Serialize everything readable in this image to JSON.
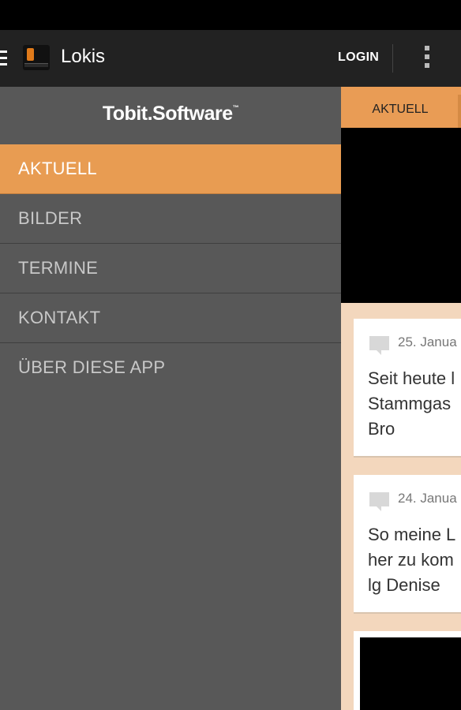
{
  "app": {
    "title": "Lokis"
  },
  "actionbar": {
    "login_label": "LOGIN"
  },
  "drawer": {
    "brand": "Tobit.Software",
    "brand_tm": "™",
    "items": [
      {
        "label": "AKTUELL",
        "active": true
      },
      {
        "label": "BILDER"
      },
      {
        "label": "TERMINE"
      },
      {
        "label": "KONTAKT"
      },
      {
        "label": "ÜBER DIESE APP"
      }
    ]
  },
  "content": {
    "tab_label": "AKTUELL",
    "posts": [
      {
        "date": "25. Janua",
        "text": "Seit heute l\nStammgas\nBro"
      },
      {
        "date": "24. Janua",
        "text": "So meine L\nher zu kom\nlg Denise"
      }
    ]
  },
  "colors": {
    "accent": "#e89c52",
    "drawer_bg": "#585858",
    "actionbar_bg": "#222222",
    "content_bg": "#f3d7bd"
  }
}
